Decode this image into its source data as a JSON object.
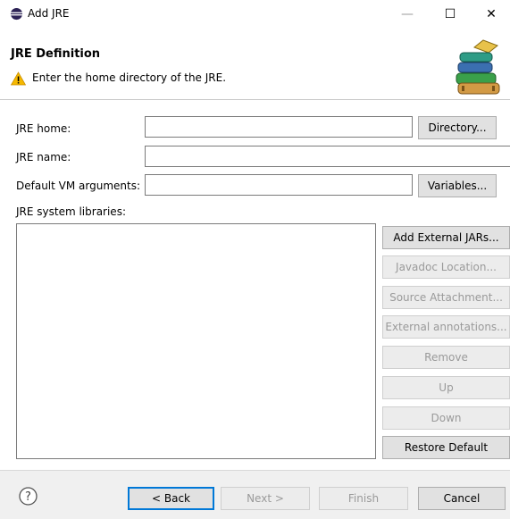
{
  "window": {
    "title": "Add JRE",
    "controls": {
      "minimize": "—",
      "maximize": "☐",
      "close": "✕"
    }
  },
  "header": {
    "title": "JRE Definition",
    "message": "Enter the home directory of the JRE."
  },
  "form": {
    "jre_home": {
      "label": "JRE home:",
      "value": ""
    },
    "jre_name": {
      "label": "JRE name:",
      "value": ""
    },
    "vm_args": {
      "label": "Default VM arguments:",
      "value": ""
    },
    "directory_button": "Directory...",
    "variables_button": "Variables...",
    "libraries_label": "JRE system libraries:"
  },
  "library_buttons": {
    "add_external_jars": "Add External JARs...",
    "javadoc_location": "Javadoc Location...",
    "source_attachment": "Source Attachment...",
    "external_annotations": "External annotations...",
    "remove": "Remove",
    "up": "Up",
    "down": "Down",
    "restore_default": "Restore Default"
  },
  "footer": {
    "help_glyph": "?",
    "back": "< Back",
    "next": "Next >",
    "finish": "Finish",
    "cancel": "Cancel"
  },
  "colors": {
    "accent": "#0078d7",
    "warning": "#f5b800",
    "disabled_text": "#9a9a9a"
  }
}
